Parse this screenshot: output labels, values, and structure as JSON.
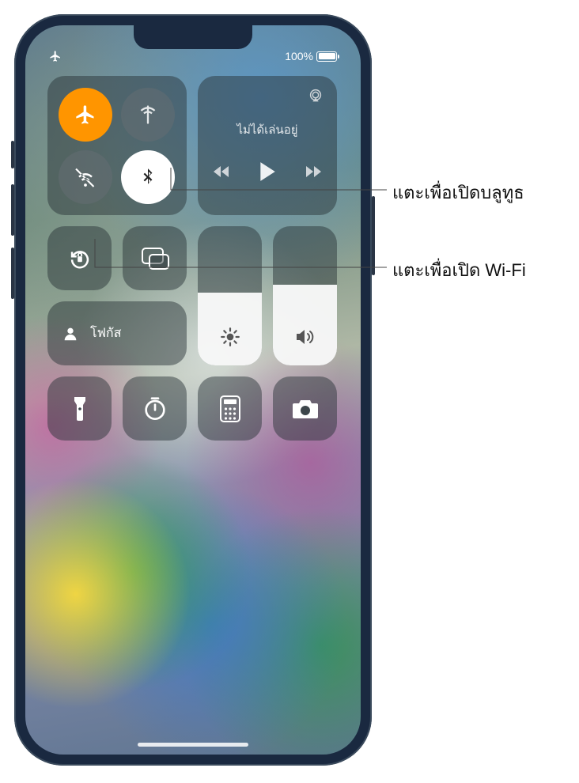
{
  "status": {
    "battery_label": "100%",
    "airplane_on": true
  },
  "connectivity": {
    "airplane": "airplane-mode",
    "cellular": "cellular-data",
    "wifi": "wifi-off",
    "bluetooth": "bluetooth-on"
  },
  "media": {
    "title": "ไม่ได้เล่นอยู่"
  },
  "focus": {
    "label": "โฟกัส"
  },
  "sliders": {
    "brightness_pct": 52,
    "volume_pct": 58
  },
  "callouts": {
    "bluetooth": "แตะเพื่อเปิดบลูทูธ",
    "wifi": "แตะเพื่อเปิด Wi-Fi"
  }
}
